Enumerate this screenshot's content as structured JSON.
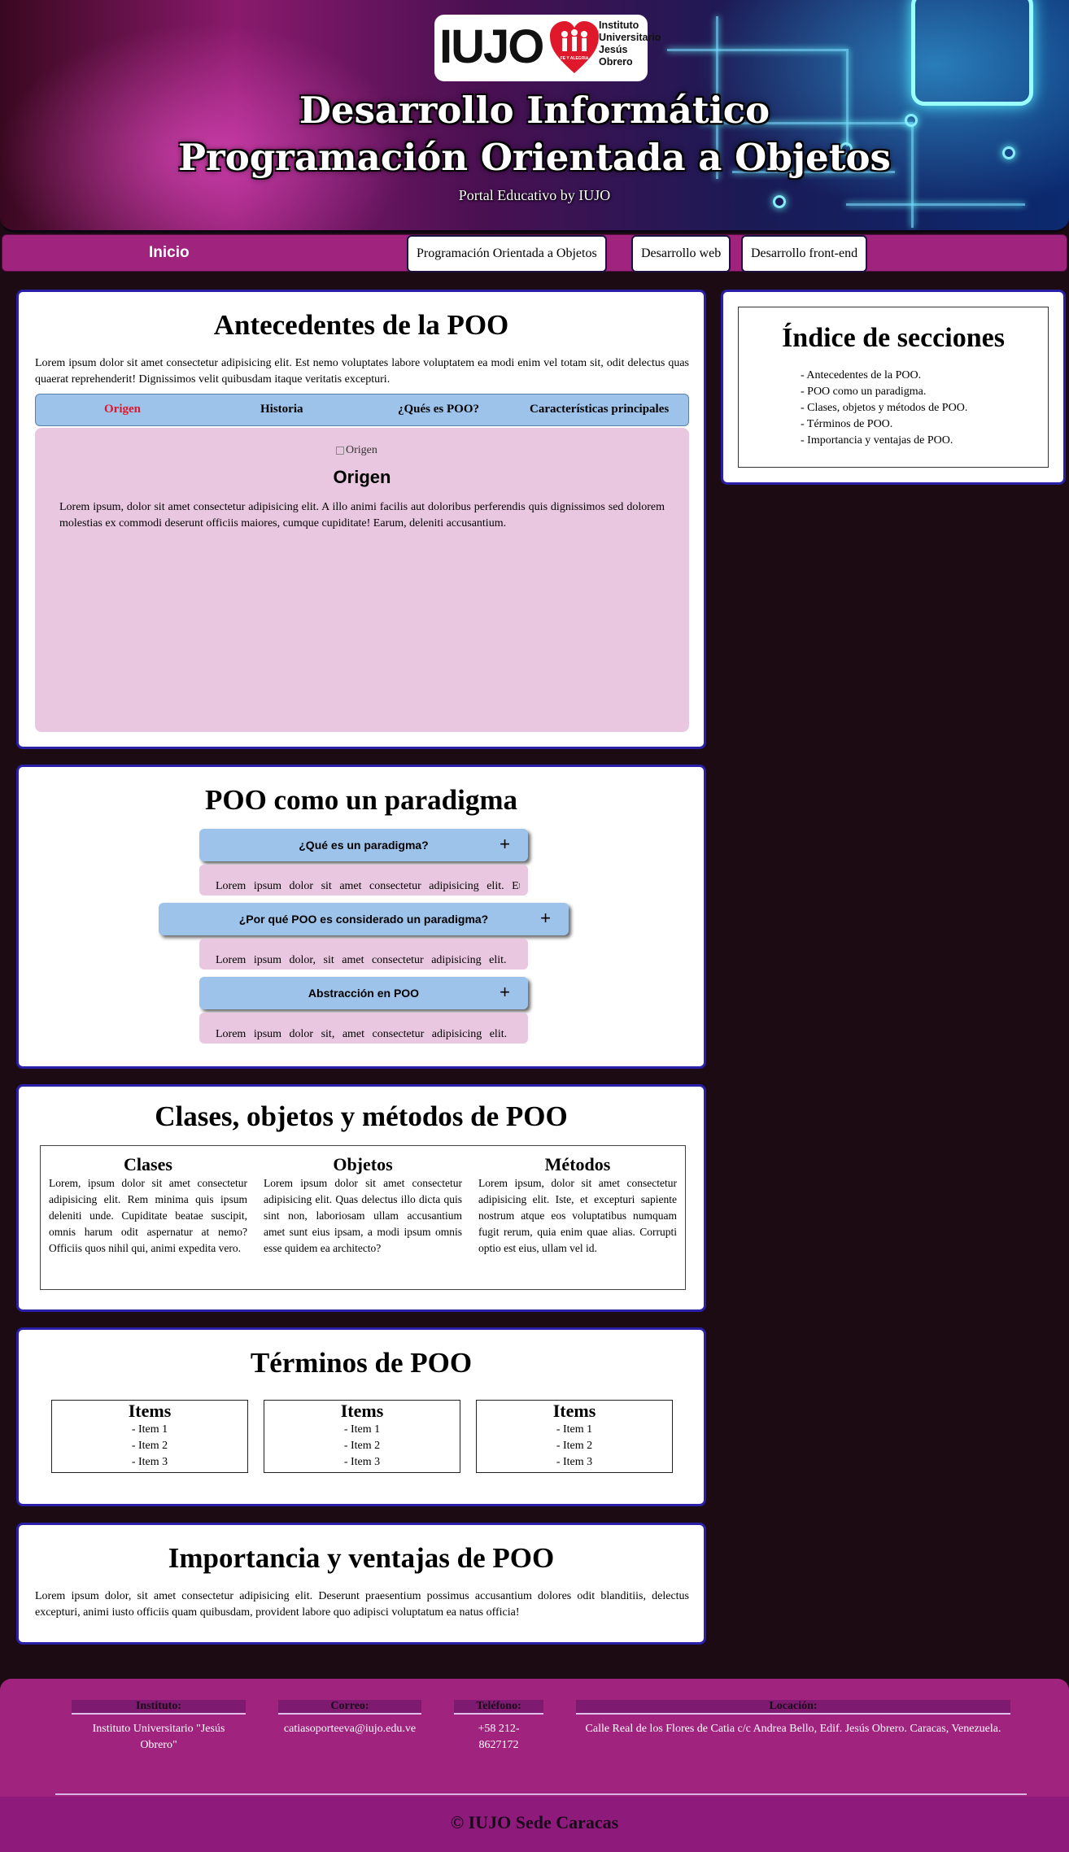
{
  "header": {
    "logo_brand": "IUJO",
    "logo_badge": "FE Y ALEGRIA",
    "logo_lines": [
      "Instituto",
      "Universitario",
      "Jesús",
      "Obrero"
    ],
    "title_line1": "Desarrollo Informático",
    "title_line2": "Programación Orientada a Objetos",
    "subtitle": "Portal Educativo by IUJO"
  },
  "nav": {
    "home": "Inicio",
    "items": [
      "Programación Orientada a Objetos",
      "Desarrollo web",
      "Desarrollo front-end"
    ]
  },
  "antecedentes": {
    "title": "Antecedentes de la POO",
    "intro": "Lorem ipsum dolor sit amet consectetur adipisicing elit. Est nemo voluptates labore voluptatem ea modi enim vel totam sit, odit delectus quas quaerat reprehenderit! Dignissimos velit quibusdam itaque veritatis excepturi.",
    "tabs": [
      "Origen",
      "Historia",
      "¿Qués es POO?",
      "Características principales"
    ],
    "active_tab": "Origen",
    "image_alt": "Origen",
    "content_title": "Origen",
    "content_text": "Lorem ipsum, dolor sit amet consectetur adipisicing elit. A illo animi facilis aut doloribus perferendis quis dignissimos sed dolorem molestias ex commodi deserunt officiis maiores, cumque cupiditate! Earum, deleniti accusantium."
  },
  "paradigma": {
    "title": "POO como un paradigma",
    "accordion": [
      {
        "question": "¿Qué es un paradigma?",
        "preview": "Lorem ipsum dolor sit amet consectetur adipisicing elit. Et"
      },
      {
        "question": "¿Por qué POO es considerado un paradigma?",
        "preview": "Lorem ipsum dolor, sit amet consectetur adipisicing elit."
      },
      {
        "question": "Abstracción en POO",
        "preview": "Lorem ipsum dolor sit, amet consectetur adipisicing elit."
      }
    ],
    "toggle_symbol": "+"
  },
  "clases": {
    "title": "Clases, objetos y métodos de POO",
    "columns": [
      {
        "title": "Clases",
        "text": "Lorem, ipsum dolor sit amet consectetur adipisicing elit. Rem minima quis ipsum deleniti unde. Cupiditate beatae suscipit, omnis harum odit aspernatur at nemo? Officiis quos nihil qui, animi expedita vero."
      },
      {
        "title": "Objetos",
        "text": "Lorem ipsum dolor sit amet consectetur adipisicing elit. Quas delectus illo dicta quis sint non, laboriosam ullam accusantium amet sunt eius ipsam, a modi ipsum omnis esse quidem ea architecto?"
      },
      {
        "title": "Métodos",
        "text": "Lorem ipsum, dolor sit amet consectetur adipisicing elit. Iste, et excepturi sapiente nostrum atque eos voluptatibus numquam fugit rerum, quia enim quae alias. Corrupti optio est eius, ullam vel id."
      }
    ]
  },
  "terminos": {
    "title": "Términos de POO",
    "boxes": [
      {
        "title": "Items",
        "items": [
          "- Item 1",
          "- Item 2",
          "- Item 3"
        ]
      },
      {
        "title": "Items",
        "items": [
          "- Item 1",
          "- Item 2",
          "- Item 3"
        ]
      },
      {
        "title": "Items",
        "items": [
          "- Item 1",
          "- Item 2",
          "- Item 3"
        ]
      }
    ]
  },
  "importancia": {
    "title": "Importancia y ventajas de POO",
    "text": "Lorem ipsum dolor, sit amet consectetur adipisicing elit. Deserunt praesentium possimus accusantium dolores odit blanditiis, delectus excepturi, animi iusto officiis quam quibusdam, provident labore quo adipisci voluptatum ea natus officia!"
  },
  "sidebar": {
    "title": "Índice de secciones",
    "items": [
      "- Antecedentes de la POO.",
      "- POO como un paradigma.",
      "- Clases, objetos y métodos de POO.",
      "- Términos de POO.",
      "- Importancia y ventajas de POO."
    ]
  },
  "footer": {
    "instituto_label": "Instituto:",
    "instituto_value": "Instituto Universitario \"Jesús Obrero\"",
    "correo_label": "Correo:",
    "correo_value": "catiasoporteeva@iujo.edu.ve",
    "telefono_label": "Teléfono:",
    "telefono_value": "+58 212-8627172",
    "locacion_label": "Locación:",
    "locacion_value": "Calle Real de los Flores de Catia c/c Andrea Bello, Edif. Jesús Obrero. Caracas, Venezuela.",
    "copyright": "© IUJO Sede Caracas"
  },
  "colors": {
    "nav_bg": "#a0237e",
    "panel_border": "#2a20a8",
    "tab_bar": "#9dc3eb",
    "tab_content": "#eac7e0",
    "active_tab": "#e0182b",
    "page_bg": "#1c0b12"
  }
}
